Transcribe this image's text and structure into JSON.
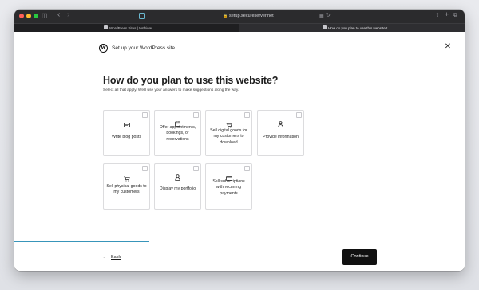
{
  "browser": {
    "url": "setup.secureserver.net",
    "tabs": [
      {
        "label": "WordPress Sites | Webinar"
      },
      {
        "label": "How do you plan to use this website?"
      }
    ]
  },
  "header": {
    "logo": "wordpress-logo",
    "title": "Set up your WordPress site"
  },
  "main": {
    "question": "How do you plan to use this website?",
    "subtext": "Select all that apply. We'll use your answers to make suggestions along the way.",
    "options": [
      {
        "label": "Write blog posts",
        "icon": "chat-icon",
        "checked": false
      },
      {
        "label": "Offer appointments, bookings, or reservations",
        "icon": "calendar-icon",
        "checked": false
      },
      {
        "label": "Sell digital goods for my customers to download",
        "icon": "cart-icon",
        "checked": false
      },
      {
        "label": "Provide information",
        "icon": "person-icon",
        "checked": false
      },
      {
        "label": "Sell physical goods to my customers",
        "icon": "cart-icon",
        "checked": false
      },
      {
        "label": "Display my portfolio",
        "icon": "person-icon",
        "checked": false
      },
      {
        "label": "Sell subscriptions with recurring payments",
        "icon": "card-icon",
        "checked": false
      }
    ]
  },
  "progress": {
    "fraction": 0.3
  },
  "footer": {
    "back_label": "Back",
    "continue_label": "Continue"
  }
}
